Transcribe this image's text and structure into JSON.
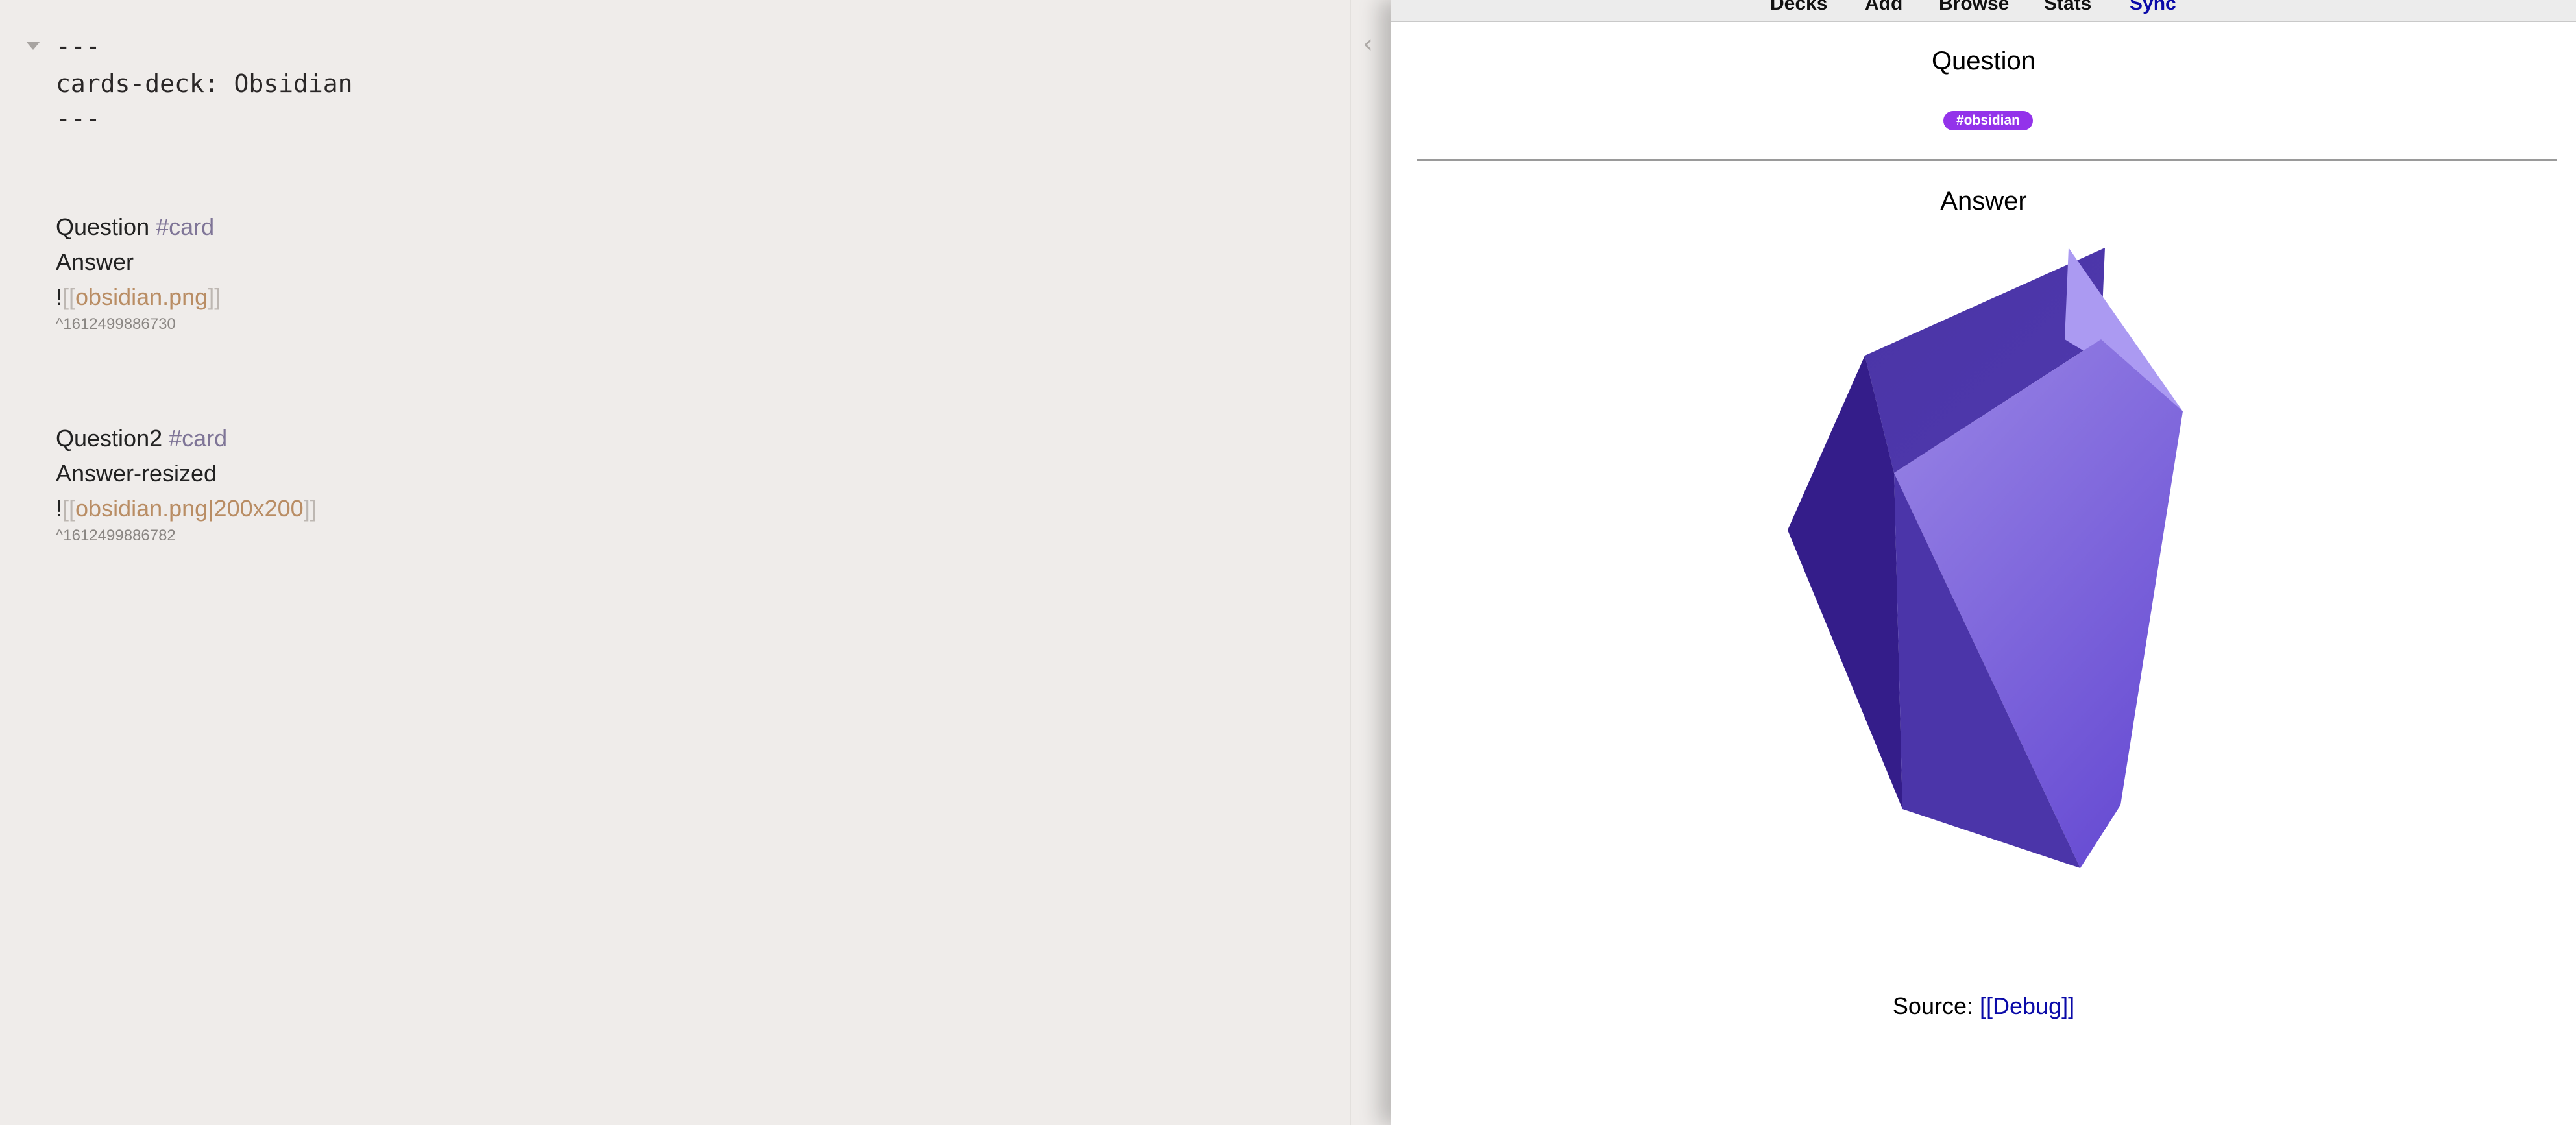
{
  "editor": {
    "frontmatter": {
      "open": "---",
      "property": "cards-deck: Obsidian",
      "close": "---"
    },
    "cards": [
      {
        "question": "Question",
        "tag": "#card",
        "answer": "Answer",
        "embed_prefix": "!",
        "embed_open": "[[",
        "embed_link": "obsidian.png",
        "embed_close": "]]",
        "block_id": "^1612499886730"
      },
      {
        "question": "Question2",
        "tag": "#card",
        "answer": "Answer-resized",
        "embed_prefix": "!",
        "embed_open": "[[",
        "embed_link": "obsidian.png|200x200",
        "embed_close": "]]",
        "block_id": "^1612499886782"
      }
    ],
    "collapse_icon": "‹"
  },
  "preview": {
    "nav": [
      {
        "label": "Decks",
        "active": false
      },
      {
        "label": "Add",
        "active": false
      },
      {
        "label": "Browse",
        "active": false
      },
      {
        "label": "Stats",
        "active": false
      },
      {
        "label": "Sync",
        "active": true
      }
    ],
    "question": "Question",
    "tag": "#obsidian",
    "answer": "Answer",
    "image_icon": "obsidian-gem-icon",
    "source_label": "Source: ",
    "source_link": "[[Debug]]"
  },
  "colors": {
    "editor_bg": "#efecea",
    "tag_text": "#7f7597",
    "link_text": "#b98d64",
    "tag_pill": "#9333ea",
    "nav_active": "#0a0aa8"
  }
}
